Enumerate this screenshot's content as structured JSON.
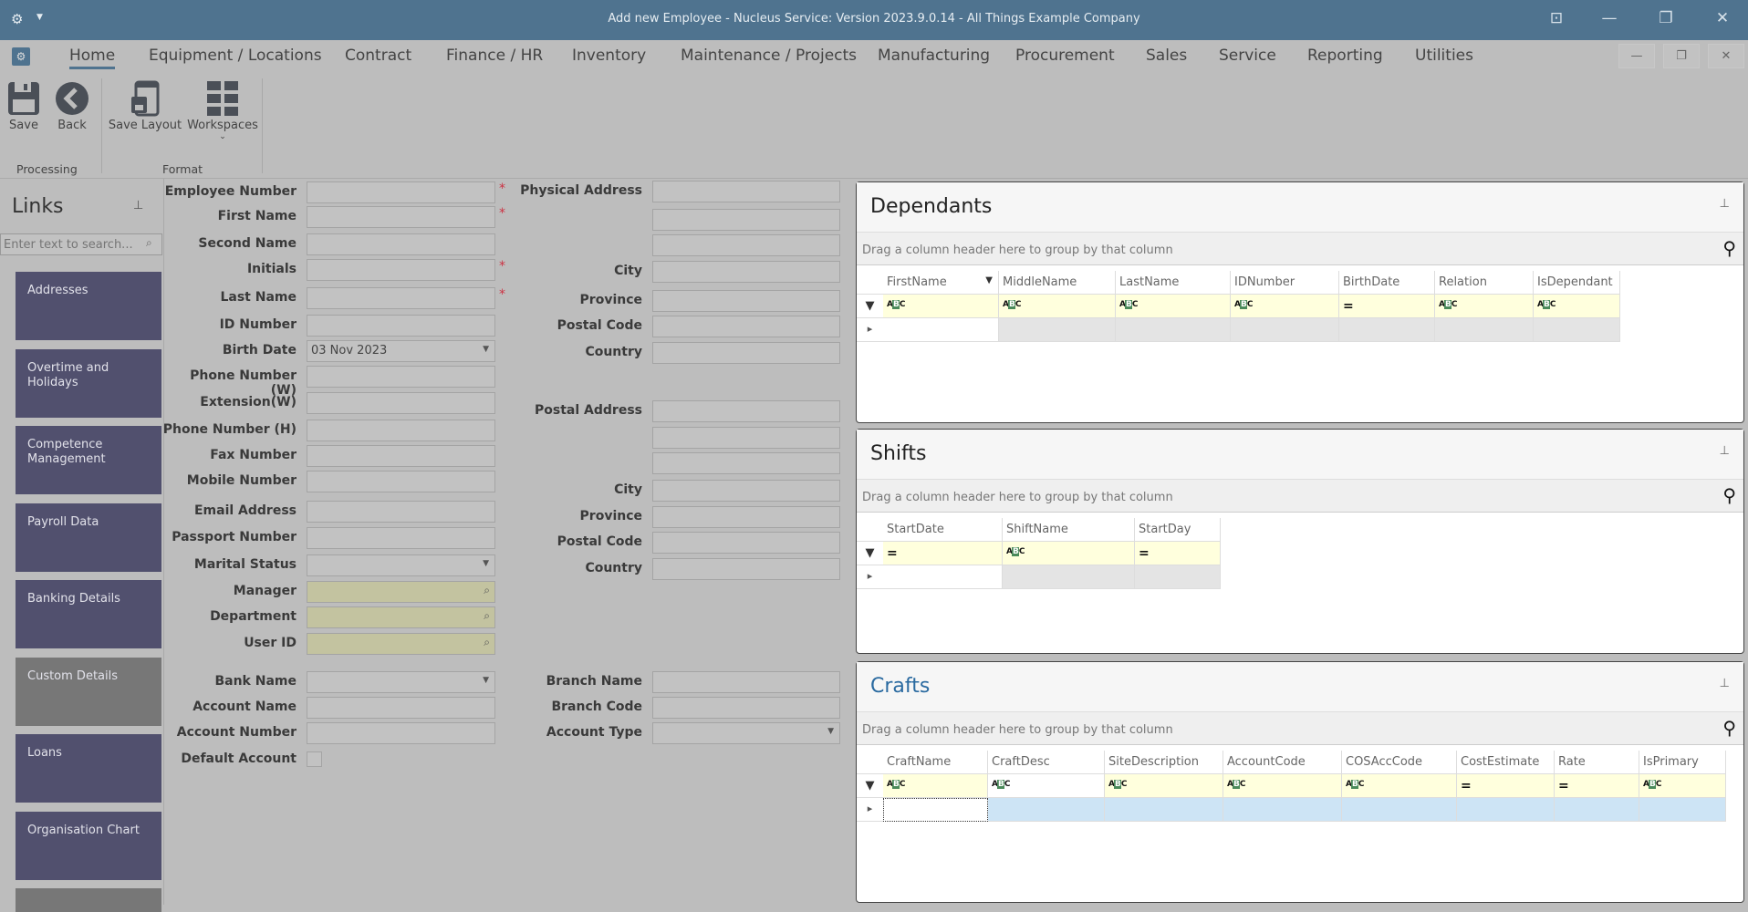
{
  "window": {
    "title": "Add new Employee - Nucleus Service: Version 2023.9.0.14 - All Things Example Company"
  },
  "tabs": [
    "Home",
    "Equipment / Locations",
    "Contract",
    "Finance / HR",
    "Inventory",
    "Maintenance / Projects",
    "Manufacturing",
    "Procurement",
    "Sales",
    "Service",
    "Reporting",
    "Utilities"
  ],
  "ribbon": {
    "save": "Save",
    "back": "Back",
    "save_layout": "Save Layout",
    "workspaces": "Workspaces",
    "group_processing": "Processing",
    "group_format": "Format"
  },
  "links": {
    "title": "Links",
    "search_placeholder": "Enter text to search...",
    "items": [
      "Addresses",
      "Overtime and Holidays",
      "Competence Management",
      "Payroll Data",
      "Banking Details",
      "Custom Details",
      "Loans",
      "Organisation Chart"
    ]
  },
  "form": {
    "left": [
      {
        "label": "Employee Number",
        "value": "",
        "required": true
      },
      {
        "label": "First Name",
        "value": "",
        "required": true
      },
      {
        "label": "Second Name",
        "value": ""
      },
      {
        "label": "Initials",
        "value": "",
        "required": true
      },
      {
        "label": "Last Name",
        "value": "",
        "required": true
      },
      {
        "label": "ID Number",
        "value": ""
      },
      {
        "label": "Birth Date",
        "value": "03 Nov 2023",
        "type": "dropdown"
      },
      {
        "label": "Phone Number (W)",
        "value": ""
      },
      {
        "label": "Extension(W)",
        "value": ""
      },
      {
        "label": "Phone Number (H)",
        "value": ""
      },
      {
        "label": "Fax Number",
        "value": ""
      },
      {
        "label": "Mobile Number",
        "value": ""
      },
      {
        "label": "Email Address",
        "value": ""
      },
      {
        "label": "Passport Number",
        "value": ""
      },
      {
        "label": "Marital Status",
        "value": "",
        "type": "dropdown"
      },
      {
        "label": "Manager",
        "value": "",
        "type": "lookup"
      },
      {
        "label": "Department",
        "value": "",
        "type": "lookup"
      },
      {
        "label": "User ID",
        "value": "",
        "type": "lookup"
      },
      {
        "label": "Bank Name",
        "value": "",
        "type": "dropdown"
      },
      {
        "label": "Account Name",
        "value": ""
      },
      {
        "label": "Account Number",
        "value": ""
      },
      {
        "label": "Default Account",
        "value": "",
        "type": "checkbox"
      }
    ],
    "right": [
      {
        "label": "Physical Address",
        "value": ""
      },
      {
        "label": "",
        "value": ""
      },
      {
        "label": "",
        "value": ""
      },
      {
        "label": "City",
        "value": ""
      },
      {
        "label": "Province",
        "value": ""
      },
      {
        "label": "Postal Code",
        "value": ""
      },
      {
        "label": "Country",
        "value": ""
      },
      {
        "label": "Postal Address",
        "value": ""
      },
      {
        "label": "",
        "value": ""
      },
      {
        "label": "",
        "value": ""
      },
      {
        "label": "City",
        "value": ""
      },
      {
        "label": "Province",
        "value": ""
      },
      {
        "label": "Postal Code",
        "value": ""
      },
      {
        "label": "Country",
        "value": ""
      },
      {
        "label": "Branch Name",
        "value": ""
      },
      {
        "label": "Branch Code",
        "value": ""
      },
      {
        "label": "Account Type",
        "value": "",
        "type": "dropdown"
      }
    ]
  },
  "panels": [
    {
      "title": "Dependants",
      "group_hint": "Drag a column header here to group by that column",
      "columns": [
        "FirstName",
        "MiddleName",
        "LastName",
        "IDNumber",
        "BirthDate",
        "Relation",
        "IsDependant"
      ],
      "filters": [
        "abc",
        "abc",
        "abc",
        "abc",
        "eq",
        "abc",
        "abc"
      ]
    },
    {
      "title": "Shifts",
      "group_hint": "Drag a column header here to group by that column",
      "columns": [
        "StartDate",
        "ShiftName",
        "StartDay"
      ],
      "filters": [
        "eq",
        "abc",
        "eq"
      ]
    },
    {
      "title": "Crafts",
      "group_hint": "Drag a column header here to group by that column",
      "columns": [
        "CraftName",
        "CraftDesc",
        "SiteDescription",
        "AccountCode",
        "COSAccCode",
        "CostEstimate",
        "Rate",
        "IsPrimary"
      ],
      "filters": [
        "abc",
        "abc",
        "abc",
        "abc",
        "abc",
        "eq",
        "eq",
        "abc"
      ]
    }
  ],
  "colors": {
    "titlebar": "#4f738f",
    "tile": "#51506e",
    "crafts_title": "#2a6aa0",
    "filter_row": "#ffffdd"
  }
}
